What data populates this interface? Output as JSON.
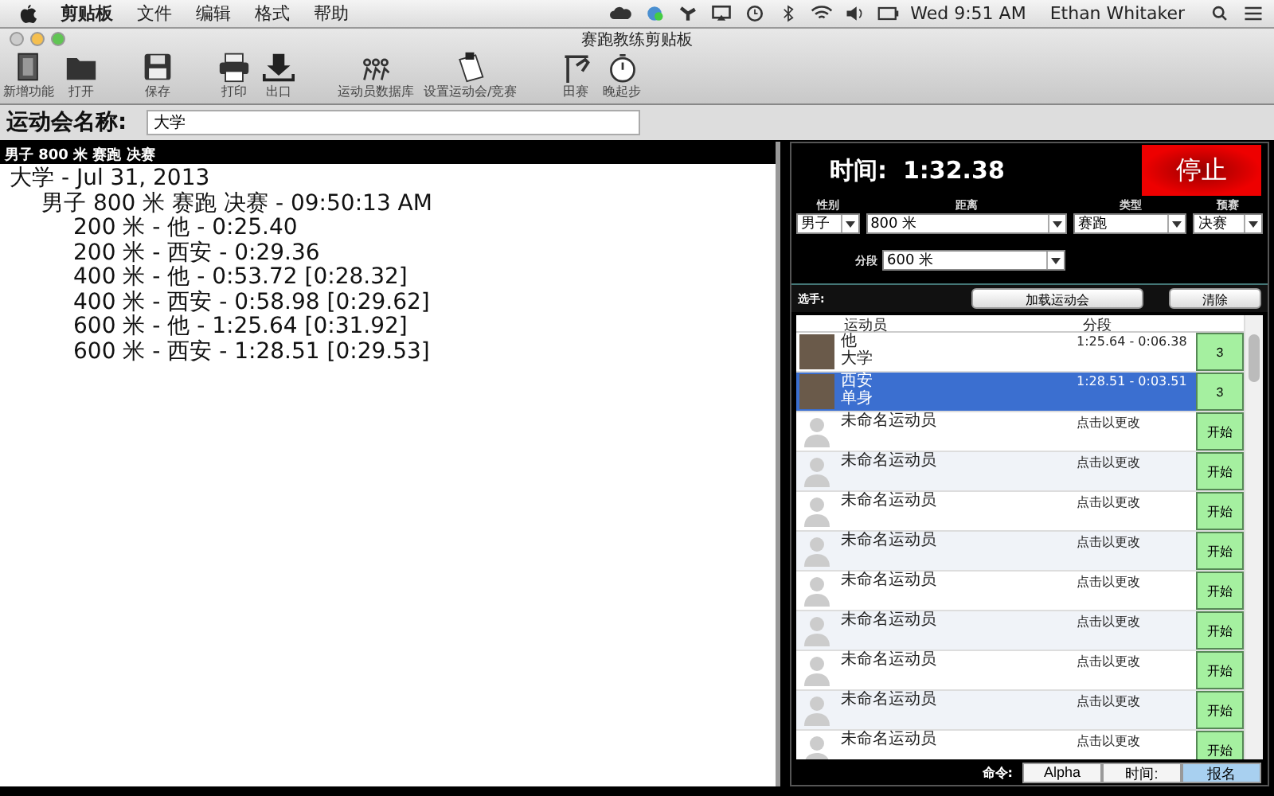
{
  "menu_bar": {
    "app_menu": "剪贴板",
    "menus": [
      "文件",
      "编辑",
      "格式",
      "帮助"
    ],
    "clock": "Wed 9:51 AM",
    "user": "Ethan Whitaker"
  },
  "window": {
    "title": "赛跑教练剪贴板"
  },
  "toolbar": [
    "新增功能",
    "打开",
    "保存",
    "打印",
    "出口",
    "运动员数据库",
    "设置运动会/竞赛",
    "田赛",
    "晚起步"
  ],
  "meet_name": {
    "label": "运动会名称:",
    "value": "大学"
  },
  "log": {
    "header": "男子 800 米 赛跑 决赛",
    "lines": [
      {
        "text": "大学 - Jul 31, 2013",
        "children": [
          {
            "text": "男子 800 米 赛跑 决赛 - 09:50:13 AM",
            "children": [
              {
                "text": "200 米 - 他 - 0:25.40"
              },
              {
                "text": "200 米 - 西安 - 0:29.36"
              },
              {
                "text": "400 米 - 他 - 0:53.72 [0:28.32]"
              },
              {
                "text": "400 米 - 西安 - 0:58.98 [0:29.62]"
              },
              {
                "text": "600 米 - 他 - 1:25.64 [0:31.92]"
              },
              {
                "text": "600 米 - 西安 - 1:28.51 [0:29.53]"
              }
            ]
          }
        ]
      }
    ]
  },
  "timer": {
    "label": "时间:",
    "value": "1:32.38",
    "stop_button": "停止"
  },
  "filters": [
    {
      "label": "性别",
      "value": "男子"
    },
    {
      "label": "距离",
      "value": "800 米"
    },
    {
      "label": "类型",
      "value": "赛跑"
    },
    {
      "label": "预赛",
      "value": "决赛"
    }
  ],
  "split": {
    "label": "分段",
    "value": "600 米"
  },
  "athletes_bar": {
    "label": "选手:",
    "load_button": "加载运动会",
    "clear_button": "清除"
  },
  "table": {
    "columns": [
      "运动员",
      "分段"
    ],
    "rows": [
      {
        "kind": "photo",
        "name": "他",
        "team": "大学",
        "split": "1:25.64 - 0:06.38",
        "action": "3",
        "selected": false
      },
      {
        "kind": "photo",
        "name": "西安",
        "team": "单身",
        "split": "1:28.51 - 0:03.51",
        "action": "3",
        "selected": true
      },
      {
        "kind": "blank",
        "name": "未命名运动员",
        "split": "点击以更改",
        "action": "开始",
        "selected": false
      },
      {
        "kind": "blank",
        "name": "未命名运动员",
        "split": "点击以更改",
        "action": "开始",
        "selected": false
      },
      {
        "kind": "blank",
        "name": "未命名运动员",
        "split": "点击以更改",
        "action": "开始",
        "selected": false
      },
      {
        "kind": "blank",
        "name": "未命名运动员",
        "split": "点击以更改",
        "action": "开始",
        "selected": false
      },
      {
        "kind": "blank",
        "name": "未命名运动员",
        "split": "点击以更改",
        "action": "开始",
        "selected": false
      },
      {
        "kind": "blank",
        "name": "未命名运动员",
        "split": "点击以更改",
        "action": "开始",
        "selected": false
      },
      {
        "kind": "blank",
        "name": "未命名运动员",
        "split": "点击以更改",
        "action": "开始",
        "selected": false
      },
      {
        "kind": "blank",
        "name": "未命名运动员",
        "split": "点击以更改",
        "action": "开始",
        "selected": false
      },
      {
        "kind": "blank",
        "name": "未命名运动员",
        "split": "点击以更改",
        "action": "开始",
        "selected": false
      }
    ]
  },
  "command_bar": {
    "label": "命令:",
    "segments": [
      {
        "label": "Alpha",
        "selected": false
      },
      {
        "label": "时间:",
        "selected": false
      },
      {
        "label": "报名",
        "selected": true
      }
    ]
  }
}
